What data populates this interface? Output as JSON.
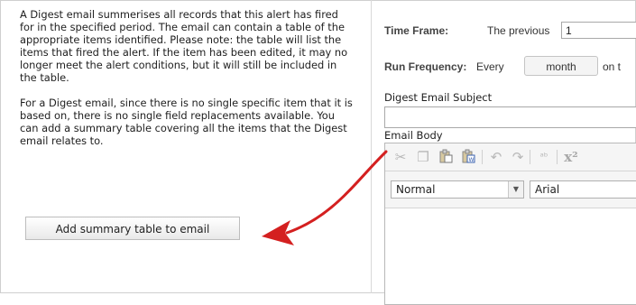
{
  "help": {
    "paragraph1": "A Digest email summerises all records that this alert has fired for in the specified period. The email can contain a table of the appropriate items identified. Please note: the table will list the items that fired the alert. If the item has been edited, it may no longer meet the alert conditions, but it will still be included in the table.",
    "paragraph2": "For a Digest email, since there is no single specific item that it is based on, there is no single field replacements available. You can add a summary table covering all the items that the Digest email relates to.",
    "summary_button": "Add summary table to email"
  },
  "form": {
    "time_frame_label": "Time Frame:",
    "time_frame_prefix": "The previous",
    "time_frame_value": "1",
    "run_frequency_label": "Run Frequency:",
    "run_frequency_every": "Every",
    "run_frequency_unit": "month",
    "run_frequency_on": "on t",
    "subject_label": "Digest Email Subject",
    "subject_value": "",
    "body_label": "Email Body"
  },
  "editor": {
    "toolbar_icons": [
      "cut-icon",
      "copy-icon",
      "paste-icon",
      "paste-word-icon",
      "undo-icon",
      "redo-icon",
      "spellcheck-icon",
      "superscript-icon"
    ],
    "format_value": "Normal",
    "font_value": "Arial"
  },
  "colors": {
    "arrow": "#d42020",
    "label": "#444444"
  }
}
